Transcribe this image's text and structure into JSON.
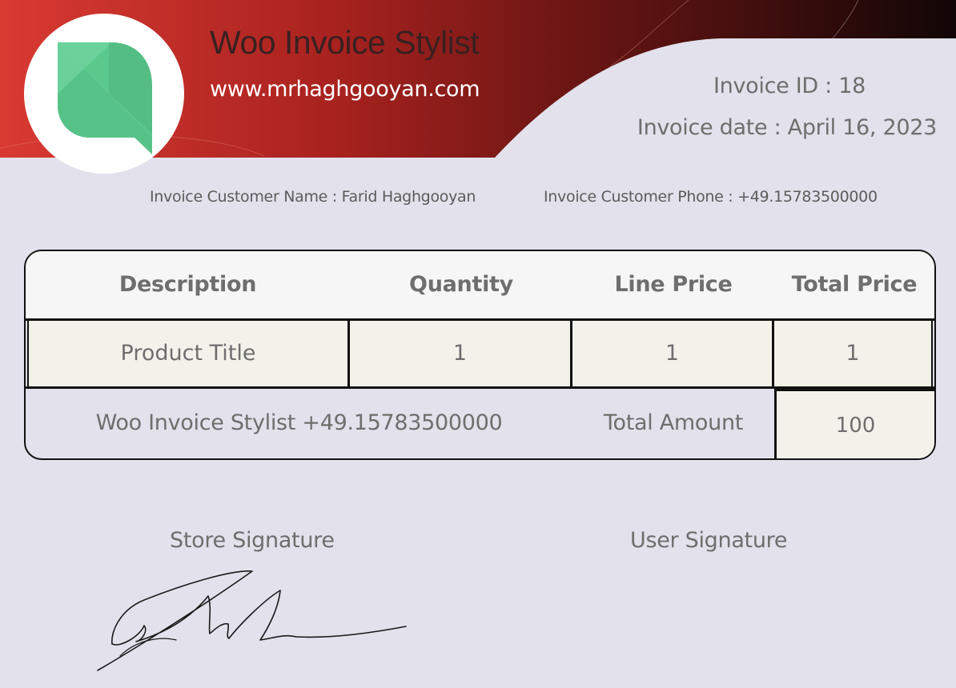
{
  "header": {
    "store_title": "Woo Invoice Stylist",
    "store_url": "www.mrhaghgooyan.com",
    "invoice_id": "Invoice ID : 18",
    "invoice_date": "Invoice date : April 16, 2023",
    "logo_icon": "leaf-chat-logo-icon"
  },
  "customer": {
    "name": "Invoice Customer Name : Farid Haghgooyan",
    "phone": "Invoice Customer Phone : +49.15783500000"
  },
  "table": {
    "headers": [
      "Description",
      "Quantity",
      "Line Price",
      "Total Price"
    ],
    "rows": [
      [
        "Product Title",
        "1",
        "1",
        "1"
      ]
    ],
    "footer_note": "Woo Invoice Stylist +49.15783500000",
    "total_label": "Total Amount",
    "total_value": "100"
  },
  "signatures": {
    "store_label": "Store Signature",
    "user_label": "User Signature"
  },
  "colors": {
    "background": "#e2e1ec",
    "header_red": "#d93a32",
    "header_dark": "#120606",
    "logo_green": "#5cc98c",
    "cell_fill": "#f3f2ea"
  }
}
